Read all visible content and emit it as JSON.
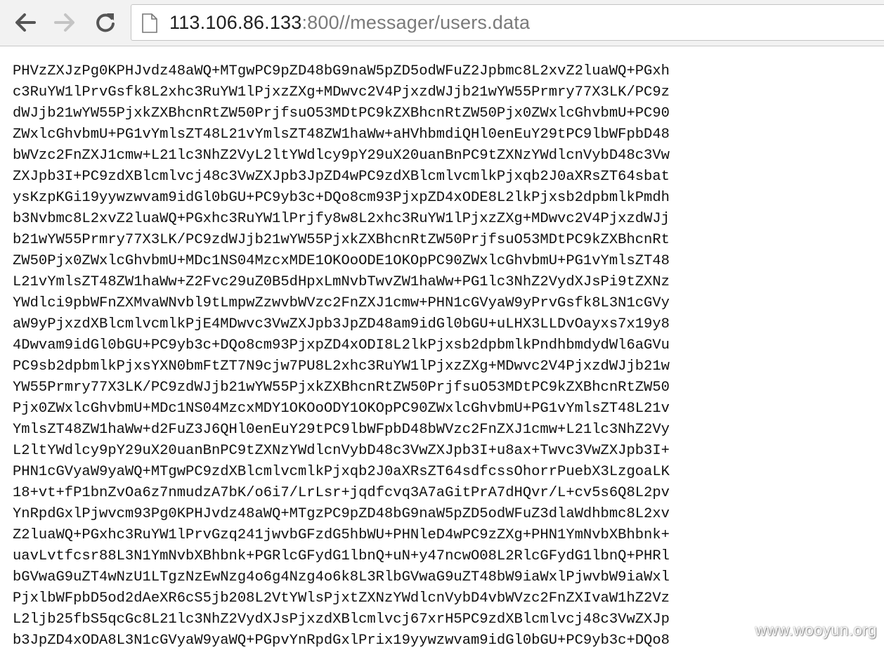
{
  "browser": {
    "icons": {
      "back": "arrow-left-icon",
      "forward": "arrow-right-icon",
      "reload": "reload-icon",
      "page": "document-icon"
    },
    "url_host": "113.106.86.133",
    "url_rest": ":800//messager/users.data"
  },
  "content": {
    "lines": [
      "PHVzZXJzPg0KPHJvdz48aWQ+MTgwPC9pZD48bG9naW5pZD5odWFuZ2Jpbmc8L2xvZ2luaWQ+PGxh",
      "c3RuYW1lPrvGsfk8L2xhc3RuYW1lPjxzZXg+MDwvc2V4PjxzdWJjb21wYW55Prmry77X3LK/PC9z",
      "dWJjb21wYW55PjxkZXBhcnRtZW50PrjfsuO53MDtPC9kZXBhcnRtZW50Pjx0ZWxlcGhvbmU+PC90",
      "ZWxlcGhvbmU+PG1vYmlsZT48L21vYmlsZT48ZW1haWw+aHVhbmdiQHl0enEuY29tPC9lbWFpbD48",
      "bWVzc2FnZXJ1cmw+L21lc3NhZ2VyL2ltYWdlcy9pY29uX20uanBnPC9tZXNzYWdlcnVybD48c3Vw",
      "ZXJpb3I+PC9zdXBlcmlvcj48c3VwZXJpb3JpZD4wPC9zdXBlcmlvcmlkPjxqb2J0aXRsZT64sbat",
      "ysKzpKGi19yywzwvam9idGl0bGU+PC9yb3c+DQo8cm93PjxpZD4xODE8L2lkPjxsb2dpbmlkPmdh",
      "b3Nvbmc8L2xvZ2luaWQ+PGxhc3RuYW1lPrjfy8w8L2xhc3RuYW1lPjxzZXg+MDwvc2V4PjxzdWJj",
      "b21wYW55Prmry77X3LK/PC9zdWJjb21wYW55PjxkZXBhcnRtZW50PrjfsuO53MDtPC9kZXBhcnRt",
      "ZW50Pjx0ZWxlcGhvbmU+MDc1NS04MzcxMDE1OKOoODE1OKOpPC90ZWxlcGhvbmU+PG1vYmlsZT48",
      "L21vYmlsZT48ZW1haWw+Z2Fvc29uZ0B5dHpxLmNvbTwvZW1haWw+PG1lc3NhZ2VydXJsPi9tZXNz",
      "YWdlci9pbWFnZXMvaWNvbl9tLmpwZzwvbWVzc2FnZXJ1cmw+PHN1cGVyaW9yPrvGsfk8L3N1cGVy",
      "aW9yPjxzdXBlcmlvcmlkPjE4MDwvc3VwZXJpb3JpZD48am9idGl0bGU+uLHX3LLDvOayxs7x19y8",
      "4Dwvam9idGl0bGU+PC9yb3c+DQo8cm93PjxpZD4xODI8L2lkPjxsb2dpbmlkPndhbmdydWl6aGVu",
      "PC9sb2dpbmlkPjxsYXN0bmFtZT7N9cjw7PU8L2xhc3RuYW1lPjxzZXg+MDwvc2V4PjxzdWJjb21w",
      "YW55Prmry77X3LK/PC9zdWJjb21wYW55PjxkZXBhcnRtZW50PrjfsuO53MDtPC9kZXBhcnRtZW50",
      "Pjx0ZWxlcGhvbmU+MDc1NS04MzcxMDY1OKOoODY1OKOpPC90ZWxlcGhvbmU+PG1vYmlsZT48L21v",
      "YmlsZT48ZW1haWw+d2FuZ3J6QHl0enEuY29tPC9lbWFpbD48bWVzc2FnZXJ1cmw+L21lc3NhZ2Vy",
      "L2ltYWdlcy9pY29uX20uanBnPC9tZXNzYWdlcnVybD48c3VwZXJpb3I+u8ax+Twvc3VwZXJpb3I+",
      "PHN1cGVyaW9yaWQ+MTgwPC9zdXBlcmlvcmlkPjxqb2J0aXRsZT64sdfcssOhorrPuebX3LzgoaLK",
      "18+vt+fP1bnZvOa6z7nmudzA7bK/o6i7/LrLsr+jqdfcvq3A7aGitPrA7dHQvr/L+cv5s6Q8L2pv",
      "YnRpdGxlPjwvcm93Pg0KPHJvdz48aWQ+MTgzPC9pZD48bG9naW5pZD5odWFuZ3dlaWdhbmc8L2xv",
      "Z2luaWQ+PGxhc3RuYW1lPrvGzq241jwvbGFzdG5hbWU+PHNleD4wPC9zZXg+PHN1YmNvbXBhbnk+",
      "uavLvtfcsr88L3N1YmNvbXBhbnk+PGRlcGFydG1lbnQ+uN+y47ncwO08L2RlcGFydG1lbnQ+PHRl",
      "bGVwaG9uZT4wNzU1LTgzNzEwNzg4o6g4Nzg4o6k8L3RlbGVwaG9uZT48bW9iaWxlPjwvbW9iaWxl",
      "PjxlbWFpbD5od2dAeXR6cS5jb208L2VtYWlsPjxtZXNzYWdlcnVybD4vbWVzc2FnZXIvaW1hZ2Vz",
      "L2ljb25fbS5qcGc8L21lc3NhZ2VydXJsPjxzdXBlcmlvcj67xrH5PC9zdXBlcmlvcj48c3VwZXJp",
      "b3JpZD4xODA8L3N1cGVyaW9yaWQ+PGpvYnRpdGxlPrix19yywzwvam9idGl0bGU+PC9yb3c+DQo8"
    ]
  },
  "watermark": "www.wooyun.org"
}
